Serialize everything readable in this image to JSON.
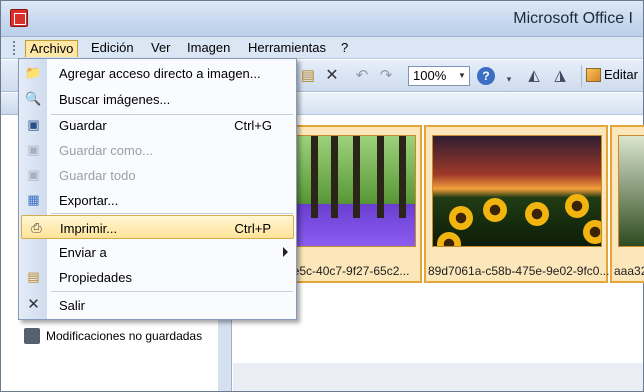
{
  "window": {
    "title": "Microsoft Office I"
  },
  "menubar": {
    "items": [
      {
        "label": "Archivo"
      },
      {
        "label": "Edición"
      },
      {
        "label": "Ver"
      },
      {
        "label": "Imagen"
      },
      {
        "label": "Herramientas"
      },
      {
        "label": "?"
      }
    ]
  },
  "toolbar": {
    "zoom_value": "100%",
    "edit_label": "Editar"
  },
  "file_menu": {
    "items": [
      {
        "label": "Agregar acceso directo a imagen...",
        "icon": "folder-add-icon",
        "shortcut": ""
      },
      {
        "label": "Buscar imágenes...",
        "icon": "search-images-icon",
        "shortcut": ""
      },
      {
        "label": "Guardar",
        "icon": "save-icon",
        "shortcut": "Ctrl+G"
      },
      {
        "label": "Guardar como...",
        "icon": "save-as-icon",
        "shortcut": ""
      },
      {
        "label": "Guardar todo",
        "icon": "save-all-icon",
        "shortcut": ""
      },
      {
        "label": "Exportar...",
        "icon": "export-icon",
        "shortcut": ""
      },
      {
        "label": "Imprimir...",
        "icon": "printer-icon",
        "shortcut": "Ctrl+P"
      },
      {
        "label": "Enviar a",
        "icon": "",
        "shortcut": ""
      },
      {
        "label": "Propiedades",
        "icon": "properties-icon",
        "shortcut": ""
      },
      {
        "label": "Salir",
        "icon": "close-icon",
        "shortcut": ""
      }
    ]
  },
  "sidebar": {
    "unsaved_label": "Modificaciones no guardadas"
  },
  "thumbnails": [
    {
      "caption": "ee5c-40c7-9f27-65c2..."
    },
    {
      "caption": "89d7061a-c58b-475e-9e02-9fc0..."
    },
    {
      "caption": "aaa32"
    }
  ],
  "colors": {
    "menu_highlight": "#ffe39a",
    "selection_border": "#e6a53a",
    "title_bar": "#c6d7ee"
  }
}
